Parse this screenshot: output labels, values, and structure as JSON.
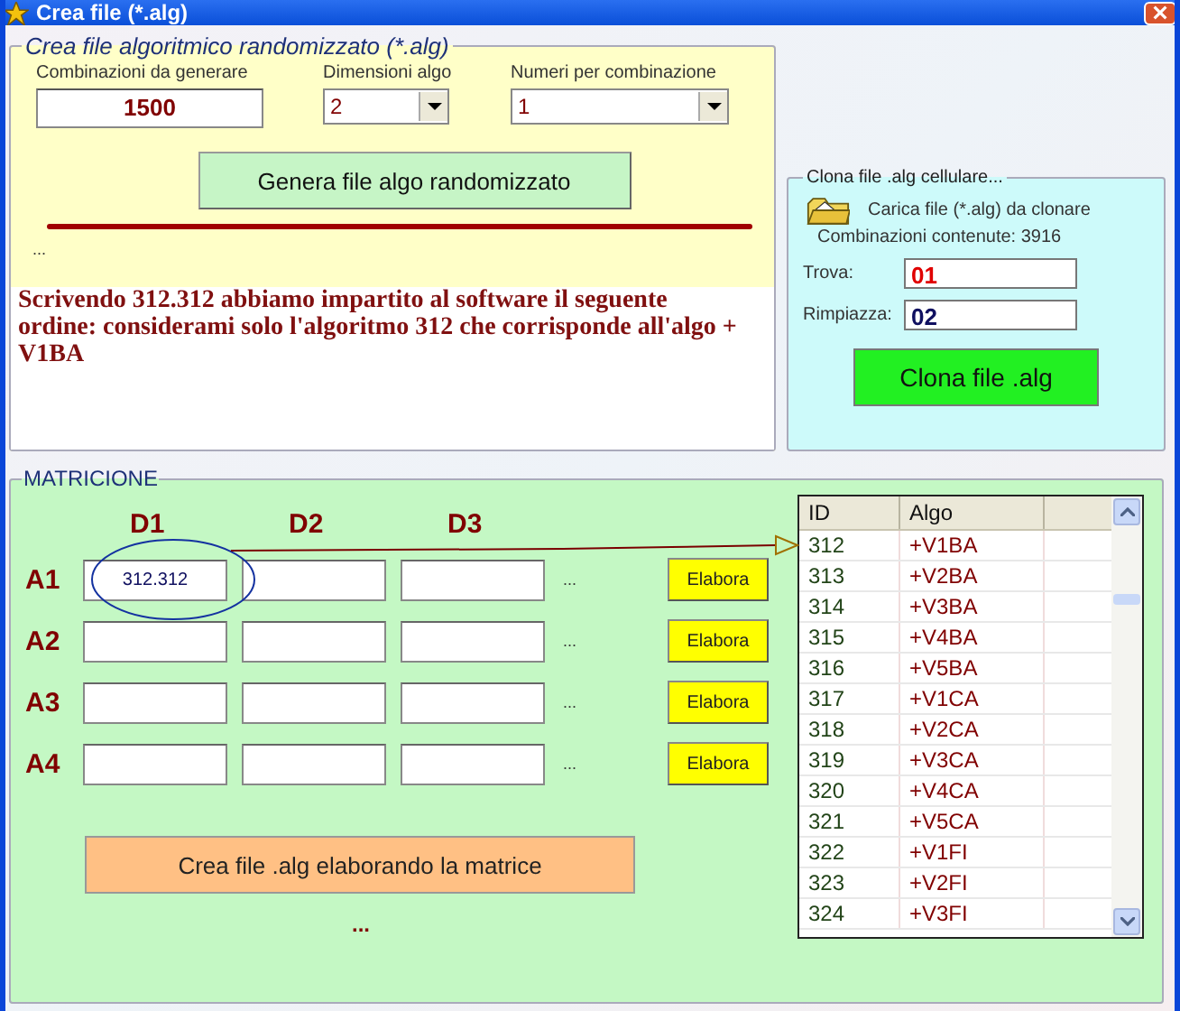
{
  "window": {
    "title": "Crea file (*.alg)"
  },
  "random_panel": {
    "title": "Crea file algoritmico randomizzato (*.alg)",
    "fields": [
      {
        "kind": "text",
        "label": "Combinazioni da generare",
        "value": "1500"
      },
      {
        "kind": "dropdown",
        "label": "Dimensioni algo",
        "value": "2"
      },
      {
        "kind": "dropdown",
        "label": "Numeri per combinazione",
        "value": "1"
      }
    ],
    "generate_button": "Genera file algo randomizzato",
    "status": "...",
    "note": "Scrivendo 312.312 abbiamo impartito al software il seguente ordine: considerami solo l'algoritmo 312 che corrisponde all'algo + V1BA"
  },
  "clone_panel": {
    "title": "Clona file .alg cellulare...",
    "load_label": "Carica file (*.alg) da clonare",
    "count": "Combinazioni contenute: 3916",
    "find": {
      "label": "Trova:",
      "value": "01"
    },
    "replace": {
      "label": "Rimpiazza:",
      "value": "02"
    },
    "button": "Clona file .alg"
  },
  "matrix": {
    "title": "MATRICIONE",
    "columns": [
      "D1",
      "D2",
      "D3"
    ],
    "rows": [
      {
        "label": "A1",
        "values": [
          "312.312"
        ],
        "more": "...",
        "button": "Elabora"
      },
      {
        "label": "A2",
        "values": [],
        "more": "...",
        "button": "Elabora"
      },
      {
        "label": "A3",
        "values": [],
        "more": "...",
        "button": "Elabora"
      },
      {
        "label": "A4",
        "values": [],
        "more": "...",
        "button": "Elabora"
      }
    ],
    "create_button": "Crea file .alg elaborando la matrice",
    "status": "..."
  },
  "table": {
    "columns": [
      "ID",
      "Algo"
    ],
    "rows": [
      [
        "312",
        "+V1BA"
      ],
      [
        "313",
        "+V2BA"
      ],
      [
        "314",
        "+V3BA"
      ],
      [
        "315",
        "+V4BA"
      ],
      [
        "316",
        "+V5BA"
      ],
      [
        "317",
        "+V1CA"
      ],
      [
        "318",
        "+V2CA"
      ],
      [
        "319",
        "+V3CA"
      ],
      [
        "320",
        "+V4CA"
      ],
      [
        "321",
        "+V5CA"
      ],
      [
        "322",
        "+V1FI"
      ],
      [
        "323",
        "+V2FI"
      ],
      [
        "324",
        "+V3FI"
      ]
    ]
  }
}
